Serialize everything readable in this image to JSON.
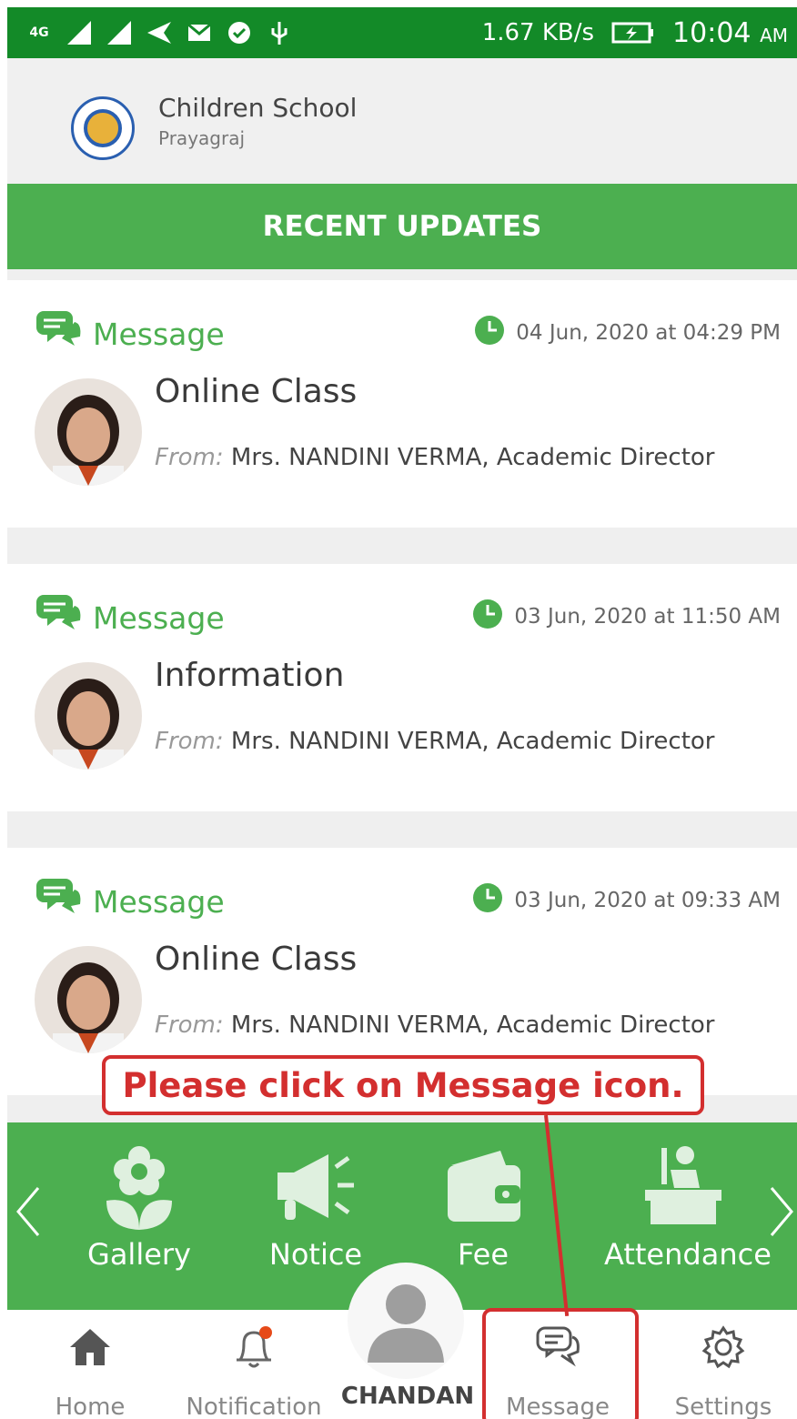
{
  "status_bar": {
    "network_label": "4G",
    "speed": "1.67 KB/s",
    "time": "10:04",
    "ampm": "AM"
  },
  "header": {
    "school_name": "Children School",
    "school_city": "Prayagraj"
  },
  "section_title": "RECENT UPDATES",
  "updates": [
    {
      "type": "Message",
      "date": "04 Jun, 2020 at 04:29 PM",
      "title": "Online Class",
      "from_label": "From:",
      "from": "Mrs. NANDINI VERMA, Academic Director"
    },
    {
      "type": "Message",
      "date": "03 Jun, 2020 at 11:50 AM",
      "title": "Information",
      "from_label": "From:",
      "from": "Mrs. NANDINI VERMA, Academic Director"
    },
    {
      "type": "Message",
      "date": "03 Jun, 2020 at 09:33 AM",
      "title": "Online Class",
      "from_label": "From:",
      "from": "Mrs. NANDINI VERMA, Academic Director"
    }
  ],
  "annotation": "Please click on Message icon.",
  "quick_menu": [
    {
      "label": "Gallery",
      "icon": "flower-icon"
    },
    {
      "label": "Notice",
      "icon": "megaphone-icon"
    },
    {
      "label": "Fee",
      "icon": "wallet-icon"
    },
    {
      "label": "Attendance",
      "icon": "student-desk-icon"
    }
  ],
  "bottom_nav": [
    {
      "label": "Home",
      "icon": "home-icon"
    },
    {
      "label": "Notification",
      "icon": "bell-icon"
    },
    {
      "label": "CHANDAN",
      "icon": "user-avatar-icon"
    },
    {
      "label": "Message",
      "icon": "chat-icon"
    },
    {
      "label": "Settings",
      "icon": "gear-icon"
    }
  ],
  "colors": {
    "status_bar": "#138a28",
    "accent_green": "#4caf50",
    "annotation_red": "#d32f2f"
  }
}
